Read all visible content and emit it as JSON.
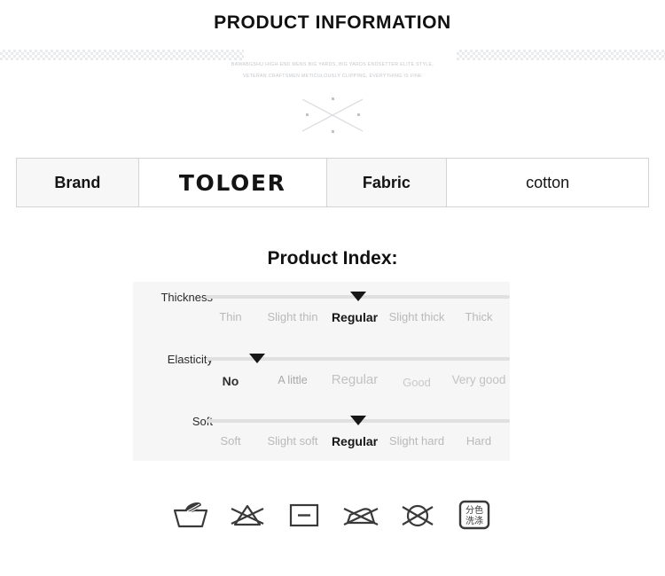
{
  "header": {
    "title": "PRODUCT INFORMATION",
    "slogan_line1": "BAWABGSHU HIGH-END MENS BIG YARDS, BIG YARDS ENDSETTER ELITE STYLE,",
    "slogan_line2": "VETERAN CRAFTSMEN METICULOUSLY CLIPPING, EVERYTHING IS FINE"
  },
  "spec_table": {
    "brand_label": "Brand",
    "brand_value": "TOLOER",
    "fabric_label": "Fabric",
    "fabric_value": "cotton"
  },
  "product_index": {
    "title": "Product Index:",
    "rows": [
      {
        "name": "Thickness",
        "options": [
          "Thin",
          "Slight thin",
          "Regular",
          "Slight thick",
          "Thick"
        ],
        "selected_index": 2,
        "marker_percent": 50
      },
      {
        "name": "Elasticity",
        "options": [
          "No",
          "A little",
          "Regular",
          "Good",
          "Very good"
        ],
        "selected_index": 0,
        "marker_percent": 17
      },
      {
        "name": "Soft",
        "options": [
          "Soft",
          "Slight soft",
          "Regular",
          "Slight hard",
          "Hard"
        ],
        "selected_index": 2,
        "marker_percent": 50
      }
    ]
  },
  "care_icons": [
    {
      "name": "hand-wash-icon",
      "label": "Hand wash"
    },
    {
      "name": "do-not-bleach-icon",
      "label": "Do not bleach"
    },
    {
      "name": "dry-flat-icon",
      "label": "Dry flat"
    },
    {
      "name": "do-not-iron-icon",
      "label": "Do not iron"
    },
    {
      "name": "do-not-dry-clean-icon",
      "label": "Do not dry clean"
    },
    {
      "name": "wash-separately-icon",
      "label": "分色洗涤",
      "line1": "分色",
      "line2": "洗涤"
    }
  ],
  "colors": {
    "text_dark": "#171717",
    "text_muted": "#b9b9b9",
    "panel_bg": "#f6f6f6",
    "cell_bg": "#f7f7f7",
    "border": "#d4d4d4",
    "track": "#e0e0e0",
    "band": "#e6e8ea"
  }
}
